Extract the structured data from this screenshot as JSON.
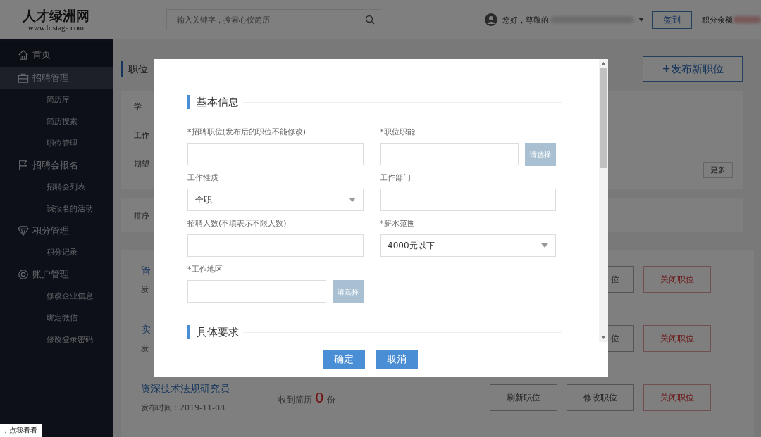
{
  "header": {
    "logo": "人才绿洲网",
    "logo_url": "www.hrstage.com",
    "search": {
      "placeholder": "输入关键字，搜索心仪简历"
    },
    "greeting": "您好，尊敬的",
    "checkin_button": "签到",
    "points_label": "积分余额"
  },
  "sidebar": {
    "items": [
      {
        "label": "首页",
        "selected": false
      },
      {
        "label": "招聘管理",
        "selected": true,
        "children": [
          {
            "label": "简历库"
          },
          {
            "label": "简历搜索"
          },
          {
            "label": "职位管理"
          }
        ]
      },
      {
        "label": "招聘会报名",
        "selected": false,
        "children": [
          {
            "label": "招聘会列表"
          },
          {
            "label": "我报名的活动"
          }
        ]
      },
      {
        "label": "积分管理",
        "selected": false,
        "children": [
          {
            "label": "积分记录"
          }
        ]
      },
      {
        "label": "账户管理",
        "selected": false,
        "children": [
          {
            "label": "修改企业信息"
          },
          {
            "label": "绑定微信"
          },
          {
            "label": "修改登录密码"
          }
        ]
      }
    ]
  },
  "main": {
    "page_title": "职位",
    "publish_button": "+发布新职位",
    "filters": [
      "学",
      "工作",
      "期望"
    ],
    "more_button": "更多",
    "sort_label": "排序",
    "jobs": [
      {
        "kind": "partial",
        "title": "管",
        "posted": "发",
        "buttons": [
          {
            "label": "位",
            "kind": "normal"
          },
          {
            "label": "关闭职位",
            "kind": "danger"
          }
        ]
      },
      {
        "kind": "partial",
        "title": "实",
        "posted": "发",
        "buttons": [
          {
            "label": "位",
            "kind": "normal"
          },
          {
            "label": "关闭职位",
            "kind": "danger"
          }
        ]
      },
      {
        "kind": "full",
        "title": "资深技术法规研究员",
        "posted": "发布时间：2019-11-08",
        "resumes_label": "收到简历",
        "resumes_count": "0",
        "resumes_unit": "份",
        "buttons": [
          {
            "label": "刷新职位",
            "kind": "normal"
          },
          {
            "label": "修改职位",
            "kind": "normal"
          },
          {
            "label": "关闭职位",
            "kind": "danger"
          }
        ]
      }
    ]
  },
  "dialog": {
    "sections": [
      {
        "title": "基本信息"
      },
      {
        "title": "具体要求"
      }
    ],
    "fields": [
      {
        "label": "*招聘职位(发布后的职位不能修改)",
        "kind": "text"
      },
      {
        "label": "*职位职能",
        "kind": "picker",
        "button": "请选择"
      },
      {
        "label": "工作性质",
        "kind": "select",
        "value": "全职"
      },
      {
        "label": "工作部门",
        "kind": "text"
      },
      {
        "label": "招聘人数(不填表示不限人数)",
        "kind": "text"
      },
      {
        "label": "*薪水范围",
        "kind": "select",
        "value": "4000元以下"
      },
      {
        "label": "*工作地区",
        "kind": "picker",
        "button": "请选择"
      }
    ],
    "buttons": [
      "确定",
      "取消"
    ]
  },
  "corner_tip": "，点我看看"
}
